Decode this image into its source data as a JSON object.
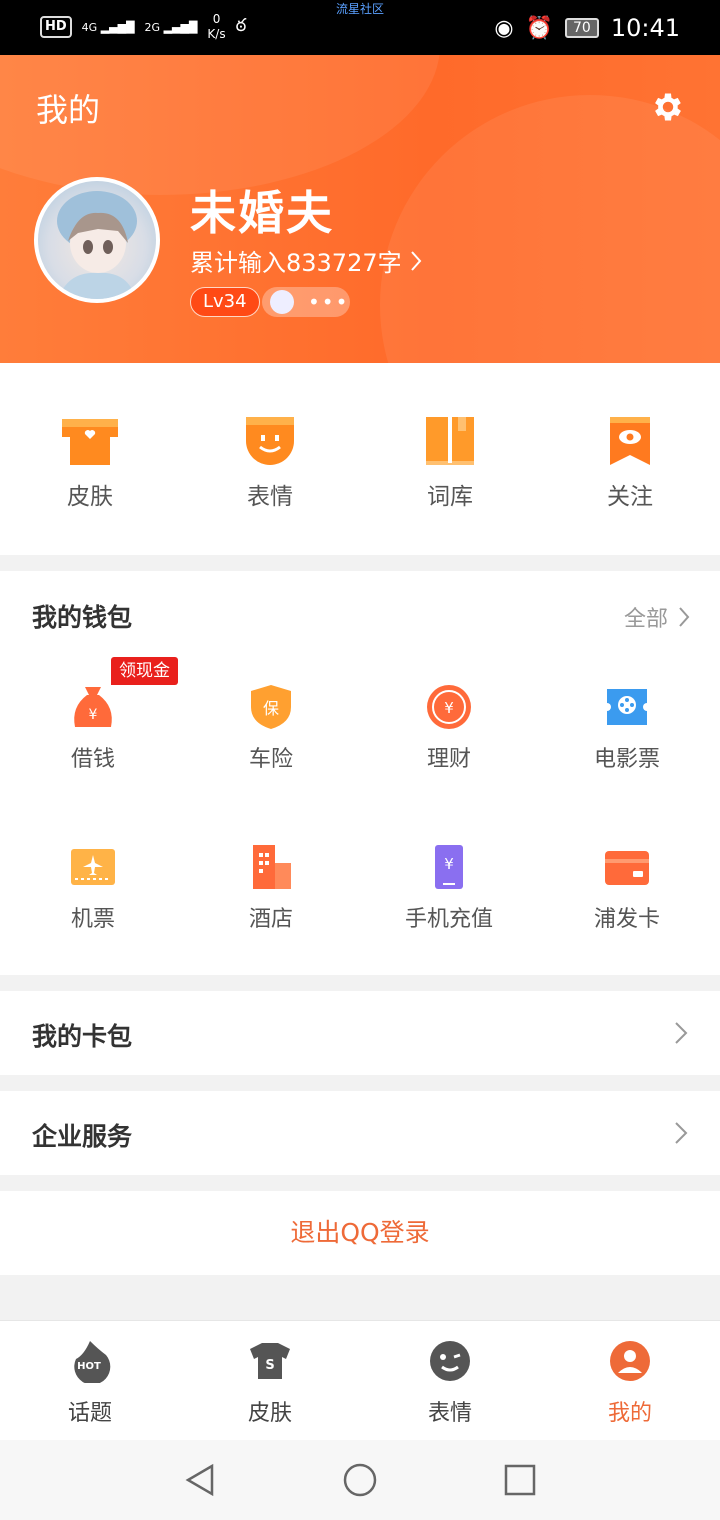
{
  "status_bar": {
    "hd": "HD",
    "net1": "4G",
    "net2": "2G",
    "speed_value": "0",
    "speed_unit": "K/s",
    "carrier": "流星社区",
    "battery": "70",
    "time": "10:41"
  },
  "header": {
    "title": "我的",
    "username": "未婚夫",
    "input_count": "累计输入833727字",
    "level": "Lv34",
    "more": "•••"
  },
  "quick_actions": [
    {
      "label": "皮肤",
      "icon": "shirt-icon"
    },
    {
      "label": "表情",
      "icon": "emoji-icon"
    },
    {
      "label": "词库",
      "icon": "book-icon"
    },
    {
      "label": "关注",
      "icon": "eye-bookmark-icon"
    }
  ],
  "wallet": {
    "title": "我的钱包",
    "all_label": "全部",
    "promo_tag": "领现金",
    "items": [
      {
        "label": "借钱",
        "icon": "money-bag-icon"
      },
      {
        "label": "车险",
        "icon": "shield-icon"
      },
      {
        "label": "理财",
        "icon": "coin-icon"
      },
      {
        "label": "电影票",
        "icon": "film-ticket-icon"
      },
      {
        "label": "机票",
        "icon": "plane-ticket-icon"
      },
      {
        "label": "酒店",
        "icon": "hotel-icon"
      },
      {
        "label": "手机充值",
        "icon": "phone-recharge-icon"
      },
      {
        "label": "浦发卡",
        "icon": "bank-card-icon"
      }
    ]
  },
  "card_wallet": {
    "title": "我的卡包"
  },
  "enterprise": {
    "title": "企业服务"
  },
  "logout": {
    "label": "退出QQ登录"
  },
  "tabs": [
    {
      "label": "话题",
      "icon": "hot-icon",
      "active": false
    },
    {
      "label": "皮肤",
      "icon": "shirt-icon",
      "active": false
    },
    {
      "label": "表情",
      "icon": "wink-icon",
      "active": false
    },
    {
      "label": "我的",
      "icon": "profile-icon",
      "active": true
    }
  ],
  "colors": {
    "accent": "#ee6a38",
    "header_bg": "#ff6a2a",
    "promo": "#e9201c"
  }
}
